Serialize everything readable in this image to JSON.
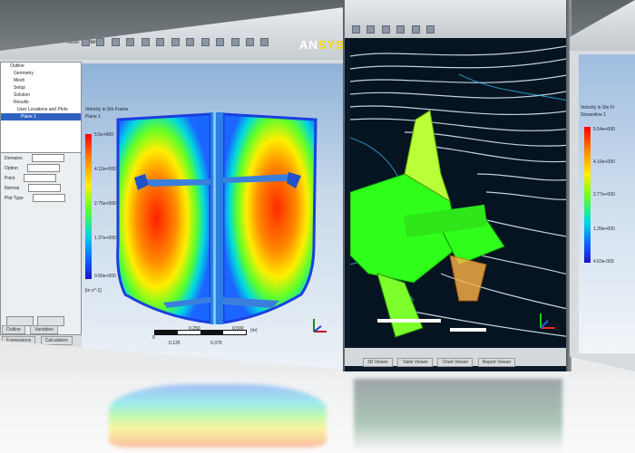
{
  "logo": {
    "text_a": "AN",
    "text_b": "SYS"
  },
  "left_window": {
    "menu": [
      "File",
      "Edit",
      "Monitor",
      "Tools",
      "Help"
    ],
    "tree": {
      "items": [
        "Outline",
        "Geometry",
        "Mesh",
        "Setup",
        "Solution",
        "Results",
        "User Locations and Plots",
        "Plane 1"
      ],
      "selected_index": 7
    },
    "details": {
      "rows": [
        "Domains",
        "Option",
        "Point",
        "Normal",
        "Plot Type"
      ]
    },
    "legend": {
      "title": "Velocity in Stn Frame",
      "subtitle": "Plane 1",
      "values": [
        "5.5e+000",
        "4.12e+000",
        "2.75e+000",
        "1.37e+000",
        "0.00e+000"
      ],
      "units": "[m s^-1]"
    },
    "scale": {
      "left": "0",
      "mid_top": "0.250",
      "right_top": "0.500",
      "unit": "(m)",
      "mid_bottom": "0.125",
      "right_bottom": "0.375"
    },
    "bottom_tabs": [
      "Outline",
      "Variables",
      "Expressions",
      "Calculators"
    ]
  },
  "middle_window": {
    "bottom_tabs": [
      "3D Viewer",
      "Table Viewer",
      "Chart Viewer",
      "Report Viewer"
    ]
  },
  "right_window": {
    "legend": {
      "title": "Velocity in Stn Fr",
      "subtitle": "Streamline 1",
      "values": [
        "5.54e+000",
        "4.16e+000",
        "2.77e+000",
        "1.39e+000",
        "4.63e-003"
      ]
    }
  },
  "colors": {
    "contour_hot": "#ff1e00",
    "contour_mid": "#ffee00",
    "contour_cool": "#00b7ff",
    "contour_cold": "#1a3fe0",
    "streamline": "#dff6ff",
    "impeller": "#2fff1a",
    "selection": "#2f62c0"
  }
}
